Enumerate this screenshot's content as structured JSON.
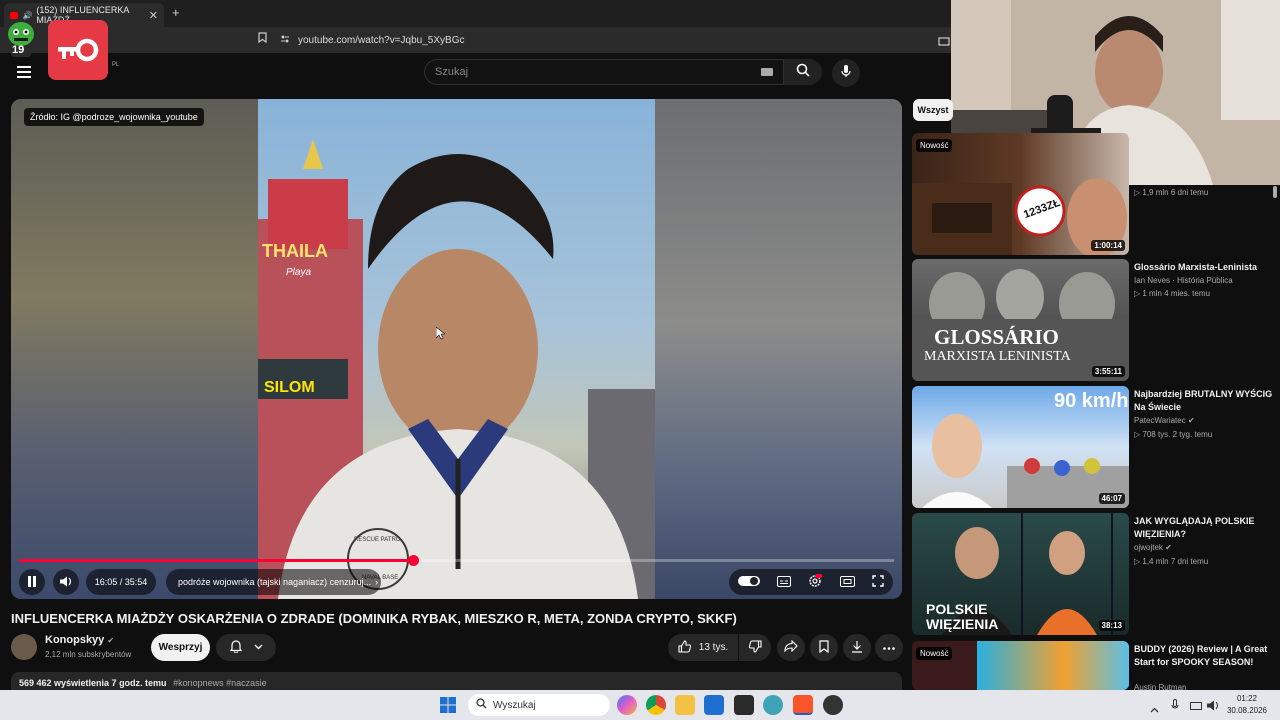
{
  "browser": {
    "tab_title": "(152) INFLUENCERKA MIAŻDŻ",
    "tab_close": "✕",
    "new_tab": "+",
    "url": "youtube.com/watch?v=Jqbu_5XyBGc"
  },
  "overlay": {
    "mascot_number": "19"
  },
  "header": {
    "logo_text": "e",
    "logo_region": "PL",
    "search_placeholder": "Szukaj"
  },
  "player": {
    "source_badge": "Źródło: IG @podroze_wojownika_youtube",
    "time": "16:05 / 35:54",
    "chapter": "podróże wojownika (tajski naganiacz) cenzuruj...",
    "progress_fraction": 0.45,
    "frame_texts": [
      "THAILA",
      "Playa",
      "SILOM",
      "RESCUE PATRO",
      "NAVAL BASE"
    ]
  },
  "video": {
    "title": "INFLUENCERKA MIAŻDŻY OSKARŻENIA O ZDRADE (DOMINIKA RYBAK, MIESZKO R, META, ZONDA CRYPTO, SKKF)",
    "channel": "Konopskyy",
    "subscribers": "2,12 mln subskrybentów",
    "support_button": "Wesprzyj",
    "likes": "13 tys.",
    "desc_views": "569 462 wyświetlenia  7 godz. temu",
    "desc_tags": "#konopnews #naczasie"
  },
  "sidebar": {
    "chip": "Wszyst",
    "recs": [
      {
        "badge": "Nowość",
        "title": "",
        "channel": "",
        "meta": "▷ 1,9 mln  6 dni temu",
        "duration": "1:00:14",
        "thumb_text": "1233ZŁ"
      },
      {
        "title": "Glossário Marxista-Leninista",
        "channel": "Ian Neves · História Pública",
        "meta": "▷ 1 mln  4 mies. temu",
        "duration": "3:55:11",
        "thumb_text": "GLOSSÁRIO",
        "thumb_text2": "MARXISTA LENINISTA"
      },
      {
        "title": "Najbardziej BRUTALNY WYŚCIG Na Świecie",
        "channel": "PatecWariatec",
        "meta": "▷ 708 tys.  2 tyg. temu",
        "duration": "46:07",
        "thumb_text": "90 km/h"
      },
      {
        "title": "JAK WYGLĄDAJĄ POLSKIE WIĘZIENIA?",
        "channel": "ojwojtek",
        "meta": "▷ 1,4 mln  7 dni temu",
        "duration": "38:13",
        "thumb_text": "POLSKIE",
        "thumb_text2": "WIĘZIENIA"
      },
      {
        "badge": "Nowość",
        "title": "BUDDY (2026) Review | A Great Start for SPOOKY SEASON!",
        "channel": "Austin Rutman",
        "meta": "",
        "duration": ""
      }
    ]
  },
  "taskbar": {
    "search": "Wyszukaj",
    "time": "01:22",
    "date": "30.08.2026"
  }
}
